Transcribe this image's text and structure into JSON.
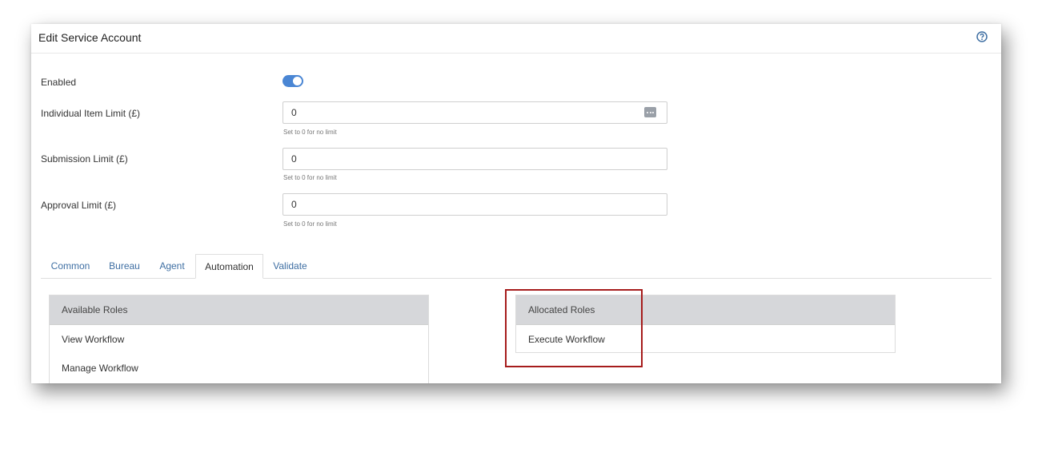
{
  "header": {
    "title": "Edit Service Account",
    "help_icon": "help-circle-icon"
  },
  "form": {
    "enabled_label": "Enabled",
    "enabled": true,
    "item_limit_label": "Individual Item Limit (£)",
    "item_limit_value": "0",
    "item_limit_hint": "Set to 0 for no limit",
    "submission_limit_label": "Submission Limit (£)",
    "submission_limit_value": "0",
    "submission_limit_hint": "Set to 0 for no limit",
    "approval_limit_label": "Approval Limit (£)",
    "approval_limit_value": "0",
    "approval_limit_hint": "Set to 0 for no limit"
  },
  "tabs": [
    "Common",
    "Bureau",
    "Agent",
    "Automation",
    "Validate"
  ],
  "active_tab": "Automation",
  "available_roles": {
    "title": "Available Roles",
    "items": [
      "View Workflow",
      "Manage Workflow"
    ]
  },
  "allocated_roles": {
    "title": "Allocated Roles",
    "items": [
      "Execute Workflow"
    ]
  },
  "colors": {
    "accent": "#4a86d4",
    "link": "#3f6fa3",
    "highlight": "#a61c1c",
    "panel_header": "#d6d7da"
  }
}
